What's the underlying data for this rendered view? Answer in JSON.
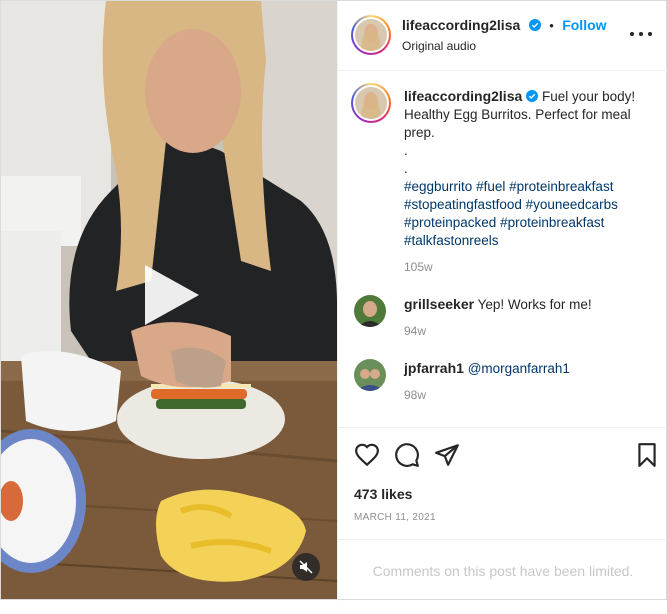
{
  "post": {
    "username": "lifeaccording2lisa",
    "separator": "•",
    "follow_label": "Follow",
    "audio_label": "Original audio"
  },
  "caption": {
    "username": "lifeaccording2lisa",
    "text_line1": "Fuel your body!",
    "text_line2": "Healthy Egg Burritos. Perfect for meal",
    "text_line3": "prep.",
    "dot1": ".",
    "dot2": ".",
    "hashtags": [
      "#eggburrito",
      "#fuel",
      "#proteinbreakfast",
      "#stopeatingfastfood",
      "#youneedcarbs",
      "#proteinpacked",
      "#proteinbreakfast",
      "#talkfastonreels"
    ],
    "time": "105w"
  },
  "comments": [
    {
      "username": "grillseeker",
      "text": "Yep! Works for me!",
      "time": "94w"
    },
    {
      "username": "jpfarrah1",
      "text": "@morganfarrah1",
      "time": "98w"
    }
  ],
  "actions": {
    "likes": "473 likes",
    "date": "MARCH 11, 2021"
  },
  "footer": {
    "limited_text": "Comments on this post have been limited."
  },
  "icons": {
    "like": "heart-icon",
    "comment": "comment-bubble-icon",
    "share": "paper-plane-icon",
    "save": "bookmark-icon",
    "play": "play-icon",
    "mute": "speaker-muted-icon",
    "more": "more-options-icon",
    "verified": "verified-badge-icon"
  },
  "colors": {
    "accent": "#0095f6",
    "hashtag": "#00376b",
    "muted": "#8e8e8e",
    "verified": "#0095f6"
  }
}
